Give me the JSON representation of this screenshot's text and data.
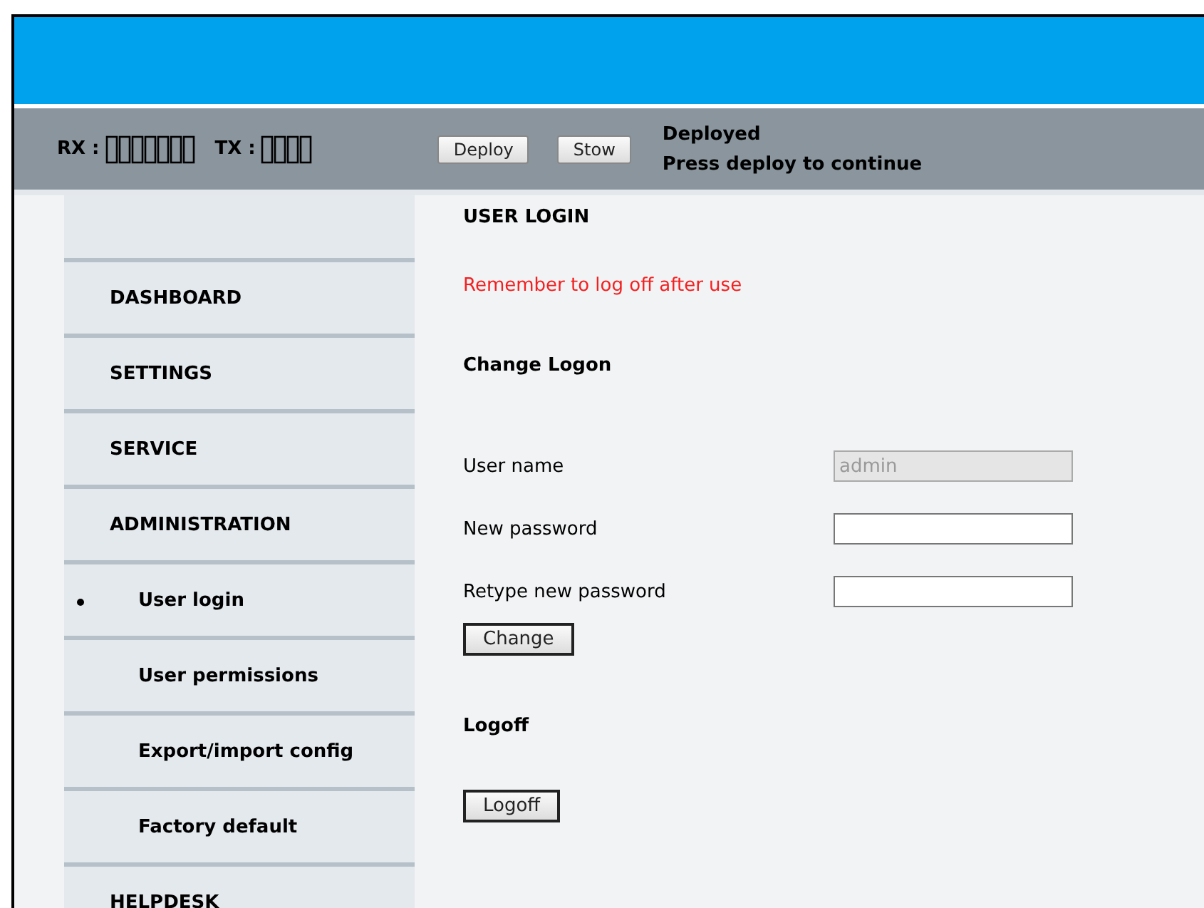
{
  "status_bar": {
    "rx_label": "RX :",
    "tx_label": "TX :",
    "buttons": [
      "Deploy",
      "Stow"
    ],
    "status_lines": [
      "Deployed",
      "Press deploy to continue"
    ]
  },
  "sidebar": {
    "items": [
      {
        "label": "DASHBOARD",
        "kind": "section",
        "selected": false
      },
      {
        "label": "SETTINGS",
        "kind": "section",
        "selected": false
      },
      {
        "label": "SERVICE",
        "kind": "section",
        "selected": false
      },
      {
        "label": "ADMINISTRATION",
        "kind": "section",
        "selected": false
      },
      {
        "label": "User login",
        "kind": "sub",
        "selected": true
      },
      {
        "label": "User permissions",
        "kind": "sub",
        "selected": false
      },
      {
        "label": "Export/import config",
        "kind": "sub",
        "selected": false
      },
      {
        "label": "Factory default",
        "kind": "sub",
        "selected": false
      },
      {
        "label": "HELPDESK",
        "kind": "section",
        "selected": false
      }
    ]
  },
  "content": {
    "title": "USER LOGIN",
    "warning": "Remember to log off after use",
    "change_heading": "Change Logon",
    "fields": [
      {
        "label": "User name",
        "value": "admin",
        "disabled": true
      },
      {
        "label": "New password",
        "disabled": false
      },
      {
        "label": "Retype new password",
        "disabled": false
      }
    ],
    "change_button": "Change",
    "logoff_heading": "Logoff",
    "logoff_button": "Logoff"
  }
}
